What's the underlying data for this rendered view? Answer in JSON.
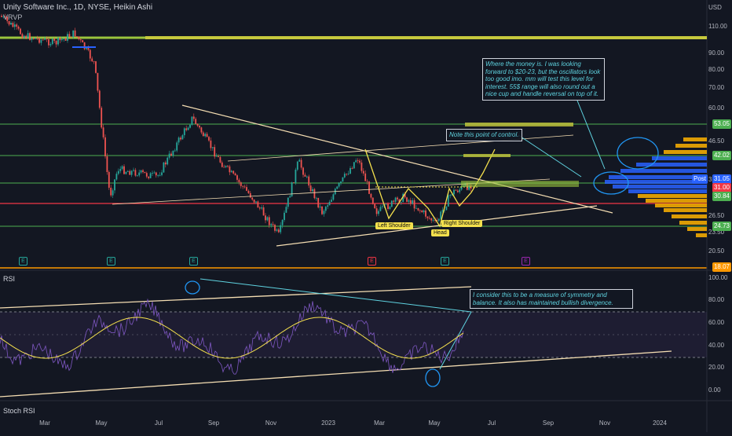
{
  "header": {
    "symbol_line": "Unity Software Inc., 1D, NYSE, Heikin Ashi",
    "indicator": "VRVP",
    "currency": "USD"
  },
  "price_axis": {
    "ticks": [
      "110.00",
      "90.00",
      "80.00",
      "70.00",
      "60.00",
      "46.50",
      "35.50",
      "26.50",
      "23.50",
      "20.50"
    ],
    "badges": [
      {
        "text": "53.05",
        "color": "#4caf50"
      },
      {
        "text": "42.02",
        "color": "#4caf50"
      },
      {
        "text": "Post",
        "color": "#2962ff"
      },
      {
        "text": "31.05",
        "color": "#2962ff"
      },
      {
        "text": "31.00",
        "color": "#f23645"
      },
      {
        "text": "30.84",
        "color": "#4caf50"
      },
      {
        "text": "24.73",
        "color": "#4caf50"
      },
      {
        "text": "18.07",
        "color": "#ff9800"
      }
    ]
  },
  "rsi_panel": {
    "label": "RSI",
    "ticks": [
      "100.00",
      "80.00",
      "60.00",
      "40.00",
      "20.00",
      "0.00"
    ]
  },
  "stoch_panel": {
    "label": "Stoch RSI"
  },
  "time_axis": {
    "labels": [
      "Mar",
      "May",
      "Jul",
      "Sep",
      "Nov",
      "2023",
      "Mar",
      "May",
      "Jul",
      "Sep",
      "Nov",
      "2024"
    ]
  },
  "annotations": {
    "money_note": "Where the money is.  I was looking forward to $20-23, but the oscillators look too good imo. mm will test this level for interest. 55$ range will also round out a nice cup and handle reversal on top of it.",
    "poc_note": "Note this point of control.",
    "rsi_note": "I consider this to be a measure of symmetry and balance. It also has maintained bullish divergence.",
    "left_shoulder": "Left Shoulder",
    "head": "Head",
    "right_shoulder": "Right Shoulder"
  },
  "earnings_markers": [
    "E",
    "E",
    "E",
    "E",
    "E",
    "E"
  ],
  "colors": {
    "bull": "#26a69a",
    "bear": "#ef5350",
    "support_line": "#4caf50",
    "resistance_line": "#f23645",
    "trend_line": "#f5deb3",
    "pattern": "#f4e04d",
    "rsi": "#7e57c2",
    "rsi_ma": "#f4e04d",
    "vol_profile_up": "#2962ff",
    "vol_profile_down": "#ffb300"
  },
  "chart_data": {
    "type": "candlestick",
    "series": [
      {
        "name": "Unity Software Inc.",
        "approx_close_path": [
          {
            "x": "2022-01",
            "y": 120
          },
          {
            "x": "2022-03",
            "y": 95
          },
          {
            "x": "2022-04",
            "y": 100
          },
          {
            "x": "2022-05",
            "y": 32
          },
          {
            "x": "2022-06",
            "y": 38
          },
          {
            "x": "2022-08",
            "y": 55
          },
          {
            "x": "2022-09",
            "y": 37
          },
          {
            "x": "2022-10",
            "y": 28
          },
          {
            "x": "2022-11",
            "y": 20
          },
          {
            "x": "2022-12",
            "y": 38
          },
          {
            "x": "2023-01",
            "y": 30
          },
          {
            "x": "2023-02",
            "y": 42
          },
          {
            "x": "2023-03",
            "y": 26
          },
          {
            "x": "2023-04",
            "y": 30
          },
          {
            "x": "2023-05",
            "y": 23
          },
          {
            "x": "2023-06",
            "y": 31
          }
        ]
      }
    ],
    "horizontal_levels": [
      53.05,
      42.02,
      30.84,
      24.73
    ],
    "last_price": 31.05,
    "rsi_levels": [
      30,
      70
    ],
    "yscale": "log"
  }
}
